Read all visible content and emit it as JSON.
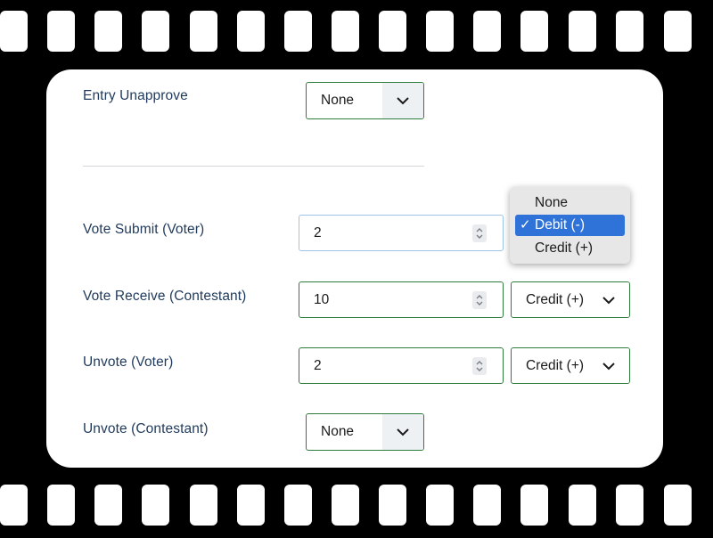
{
  "form": {
    "entry_unapprove": {
      "label": "Entry Unapprove",
      "select": "None"
    },
    "vote_submit": {
      "label": "Vote Submit (Voter)",
      "value": "2"
    },
    "vote_receive": {
      "label": "Vote Receive (Contestant)",
      "value": "10",
      "select": "Credit (+)"
    },
    "unvote_voter": {
      "label": "Unvote (Voter)",
      "value": "2",
      "select": "Credit (+)"
    },
    "unvote_contestant": {
      "label": "Unvote (Contestant)",
      "select": "None"
    }
  },
  "dropdown": {
    "options": [
      "None",
      "Debit (-)",
      "Credit (+)"
    ],
    "selected": "Debit (-)",
    "check_glyph": "✓"
  },
  "colors": {
    "label": "#1f3a5c",
    "border": "#2f7d3c",
    "highlight": "#2f73d8",
    "background": "#000000",
    "card": "#ffffff"
  },
  "icons": {
    "select_arrow": "chevron-down-icon",
    "number_spinner": "spinner-updown-icon",
    "selected_option": "checkmark-icon"
  }
}
